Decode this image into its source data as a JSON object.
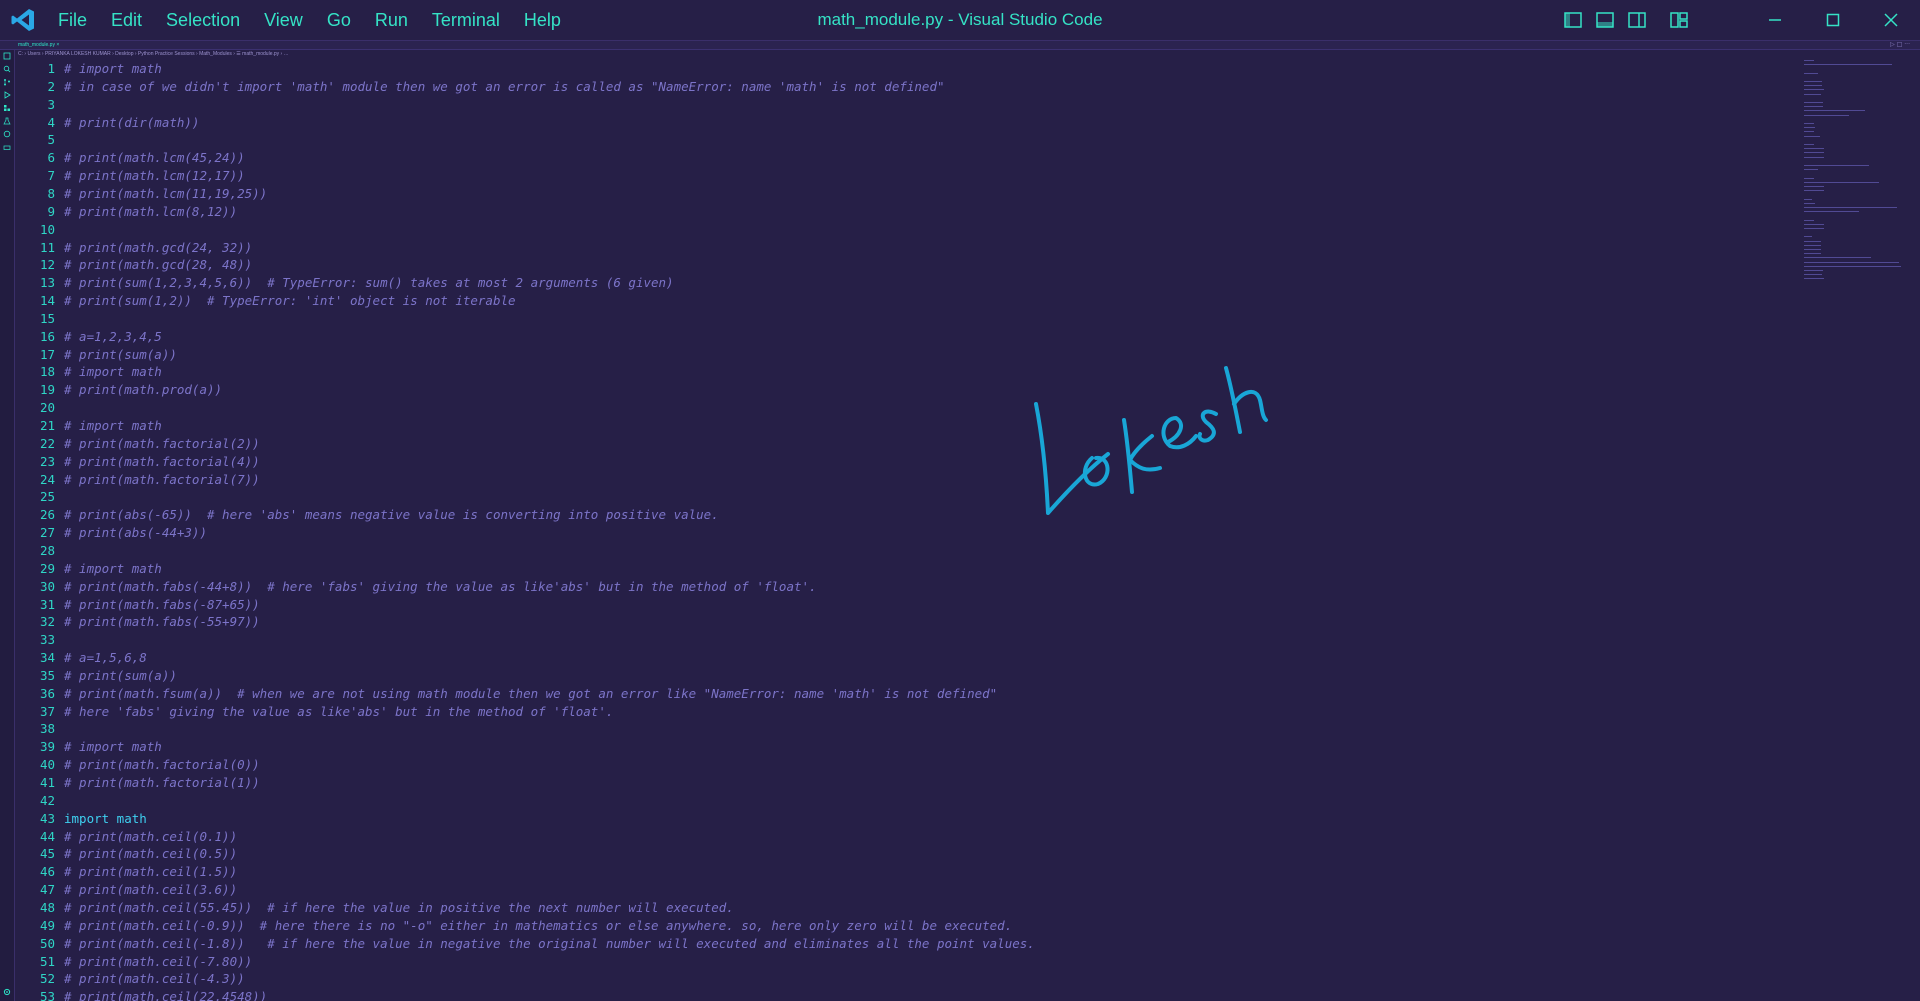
{
  "window": {
    "title": "math_module.py - Visual Studio Code"
  },
  "menu": [
    "File",
    "Edit",
    "Selection",
    "View",
    "Go",
    "Run",
    "Terminal",
    "Help"
  ],
  "tab": {
    "label": "math_module.py  ×"
  },
  "editor_actions": "▷ □ ···",
  "breadcrumb": "C: › Users › PRIYANKA LOKESH KUMAR › Desktop › Python Practice Sessions › Math_Modules › ☰ math_module.py › …",
  "signature": "Lokesh",
  "colors": {
    "background": "#261f47",
    "accent": "#35e3c6",
    "comment": "#7c74c9",
    "keyword": "#3ed0f0",
    "signature": "#19a6d6"
  },
  "code_lines": [
    {
      "n": "1",
      "text": "# import math"
    },
    {
      "n": "2",
      "text": "# in case of we didn't import 'math' module then we got an error is called as \"NameError: name 'math' is not defined\""
    },
    {
      "n": "3",
      "text": ""
    },
    {
      "n": "4",
      "text": "# print(dir(math))"
    },
    {
      "n": "5",
      "text": ""
    },
    {
      "n": "6",
      "text": "# print(math.lcm(45,24))"
    },
    {
      "n": "7",
      "text": "# print(math.lcm(12,17))"
    },
    {
      "n": "8",
      "text": "# print(math.lcm(11,19,25))"
    },
    {
      "n": "9",
      "text": "# print(math.lcm(8,12))"
    },
    {
      "n": "10",
      "text": ""
    },
    {
      "n": "11",
      "text": "# print(math.gcd(24, 32))"
    },
    {
      "n": "12",
      "text": "# print(math.gcd(28, 48))"
    },
    {
      "n": "13",
      "text": "# print(sum(1,2,3,4,5,6))  # TypeError: sum() takes at most 2 arguments (6 given)"
    },
    {
      "n": "14",
      "text": "# print(sum(1,2))  # TypeError: 'int' object is not iterable"
    },
    {
      "n": "15",
      "text": ""
    },
    {
      "n": "16",
      "text": "# a=1,2,3,4,5"
    },
    {
      "n": "17",
      "text": "# print(sum(a))"
    },
    {
      "n": "18",
      "text": "# import math"
    },
    {
      "n": "19",
      "text": "# print(math.prod(a))"
    },
    {
      "n": "20",
      "text": ""
    },
    {
      "n": "21",
      "text": "# import math"
    },
    {
      "n": "22",
      "text": "# print(math.factorial(2))"
    },
    {
      "n": "23",
      "text": "# print(math.factorial(4))"
    },
    {
      "n": "24",
      "text": "# print(math.factorial(7))"
    },
    {
      "n": "25",
      "text": ""
    },
    {
      "n": "26",
      "text": "# print(abs(-65))  # here 'abs' means negative value is converting into positive value."
    },
    {
      "n": "27",
      "text": "# print(abs(-44+3))"
    },
    {
      "n": "28",
      "text": ""
    },
    {
      "n": "29",
      "text": "# import math"
    },
    {
      "n": "30",
      "text": "# print(math.fabs(-44+8))  # here 'fabs' giving the value as like'abs' but in the method of 'float'."
    },
    {
      "n": "31",
      "text": "# print(math.fabs(-87+65))"
    },
    {
      "n": "32",
      "text": "# print(math.fabs(-55+97))"
    },
    {
      "n": "33",
      "text": ""
    },
    {
      "n": "34",
      "text": "# a=1,5,6,8"
    },
    {
      "n": "35",
      "text": "# print(sum(a))"
    },
    {
      "n": "36",
      "text": "# print(math.fsum(a))  # when we are not using math module then we got an error like \"NameError: name 'math' is not defined\""
    },
    {
      "n": "37",
      "text": "# here 'fabs' giving the value as like'abs' but in the method of 'float'."
    },
    {
      "n": "38",
      "text": ""
    },
    {
      "n": "39",
      "text": "# import math"
    },
    {
      "n": "40",
      "text": "# print(math.factorial(0))"
    },
    {
      "n": "41",
      "text": "# print(math.factorial(1))"
    },
    {
      "n": "42",
      "text": ""
    },
    {
      "n": "43",
      "text": "import math",
      "kind": "code"
    },
    {
      "n": "44",
      "text": "# print(math.ceil(0.1))"
    },
    {
      "n": "45",
      "text": "# print(math.ceil(0.5))"
    },
    {
      "n": "46",
      "text": "# print(math.ceil(1.5))"
    },
    {
      "n": "47",
      "text": "# print(math.ceil(3.6))"
    },
    {
      "n": "48",
      "text": "# print(math.ceil(55.45))  # if here the value in positive the next number will executed."
    },
    {
      "n": "49",
      "text": "# print(math.ceil(-0.9))  # here there is no \"-o\" either in mathematics or else anywhere. so, here only zero will be executed."
    },
    {
      "n": "50",
      "text": "# print(math.ceil(-1.8))   # if here the value in negative the original number will executed and eliminates all the point values."
    },
    {
      "n": "51",
      "text": "# print(math.ceil(-7.80))"
    },
    {
      "n": "52",
      "text": "# print(math.ceil(-4.3))"
    },
    {
      "n": "53",
      "text": "# print(math.ceil(22.4548))"
    }
  ]
}
